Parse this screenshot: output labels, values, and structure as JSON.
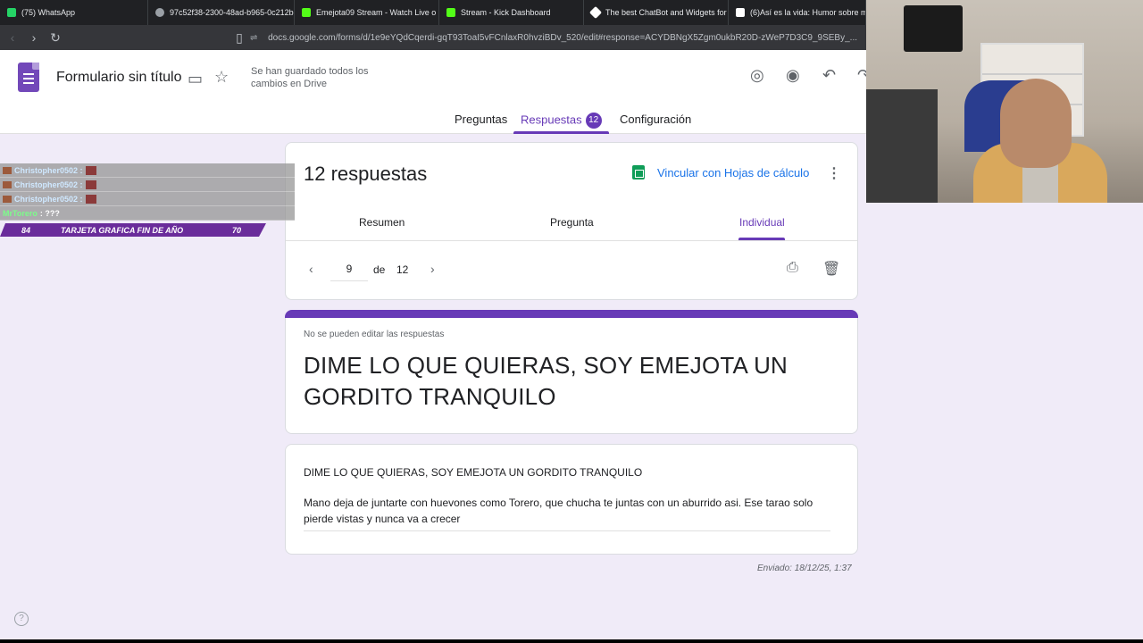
{
  "browser": {
    "tabs": [
      {
        "label": "(75) WhatsApp",
        "color": "#25d366"
      },
      {
        "label": "97c52f38-2300-48ad-b965-0c212b6",
        "color": "#9aa0a6"
      },
      {
        "label": "Emejota09 Stream - Watch Live o",
        "color": "#53fc18"
      },
      {
        "label": "Stream - Kick Dashboard",
        "color": "#53fc18"
      },
      {
        "label": "The best ChatBot and Widgets for K",
        "color": "#ffffff"
      },
      {
        "label": "(6)Así es la vida: Humor sobre mamá",
        "color": "#ffffff"
      }
    ],
    "url": "docs.google.com/forms/d/1e9eYQdCqerdi-gqT93ToaI5vFCnlaxR0hvziBDv_520/edit#response=ACYDBNgX5Zgm0ukbR20D-zWeP7D3C9_9SEBy_..."
  },
  "header": {
    "title": "Formulario sin título",
    "save_status": "Se han guardado todos los cambios en Drive",
    "tabs": {
      "preguntas": "Preguntas",
      "respuestas": "Respuestas",
      "respuestas_count": "12",
      "configuracion": "Configuración"
    }
  },
  "summary": {
    "count_label": "12 respuestas",
    "link_sheets": "Vincular con Hojas de cálculo",
    "subtabs": {
      "resumen": "Resumen",
      "pregunta": "Pregunta",
      "individual": "Individual"
    },
    "pager": {
      "current": "9",
      "de": "de",
      "total": "12"
    }
  },
  "response": {
    "no_edit": "No se pueden editar las respuestas",
    "form_title": "DIME LO QUE QUIERAS, SOY EMEJOTA UN GORDITO TRANQUILO",
    "question": "DIME LO QUE QUIERAS, SOY EMEJOTA UN GORDITO TRANQUILO",
    "answer": "Mano deja de juntarte con huevones como Torero, que chucha te juntas con un aburrido asi. Ese tarao solo pierde vistas y nunca va a crecer",
    "sent": "Enviado: 18/12/25, 1:37"
  },
  "overlay": {
    "chat": [
      {
        "user": "Christopher0502 :",
        "msg": ""
      },
      {
        "user": "Christopher0502 :",
        "msg": ""
      },
      {
        "user": "Christopher0502 :",
        "msg": ""
      },
      {
        "user": "MrTorero",
        "msg": ": ???"
      }
    ],
    "goal": {
      "left": "84",
      "label": "TARJETA GRAFICA FIN DE AÑO",
      "right": "70"
    }
  },
  "colors": {
    "accent": "#673ab7",
    "link": "#1a73e8",
    "background": "#f0ebf8"
  }
}
